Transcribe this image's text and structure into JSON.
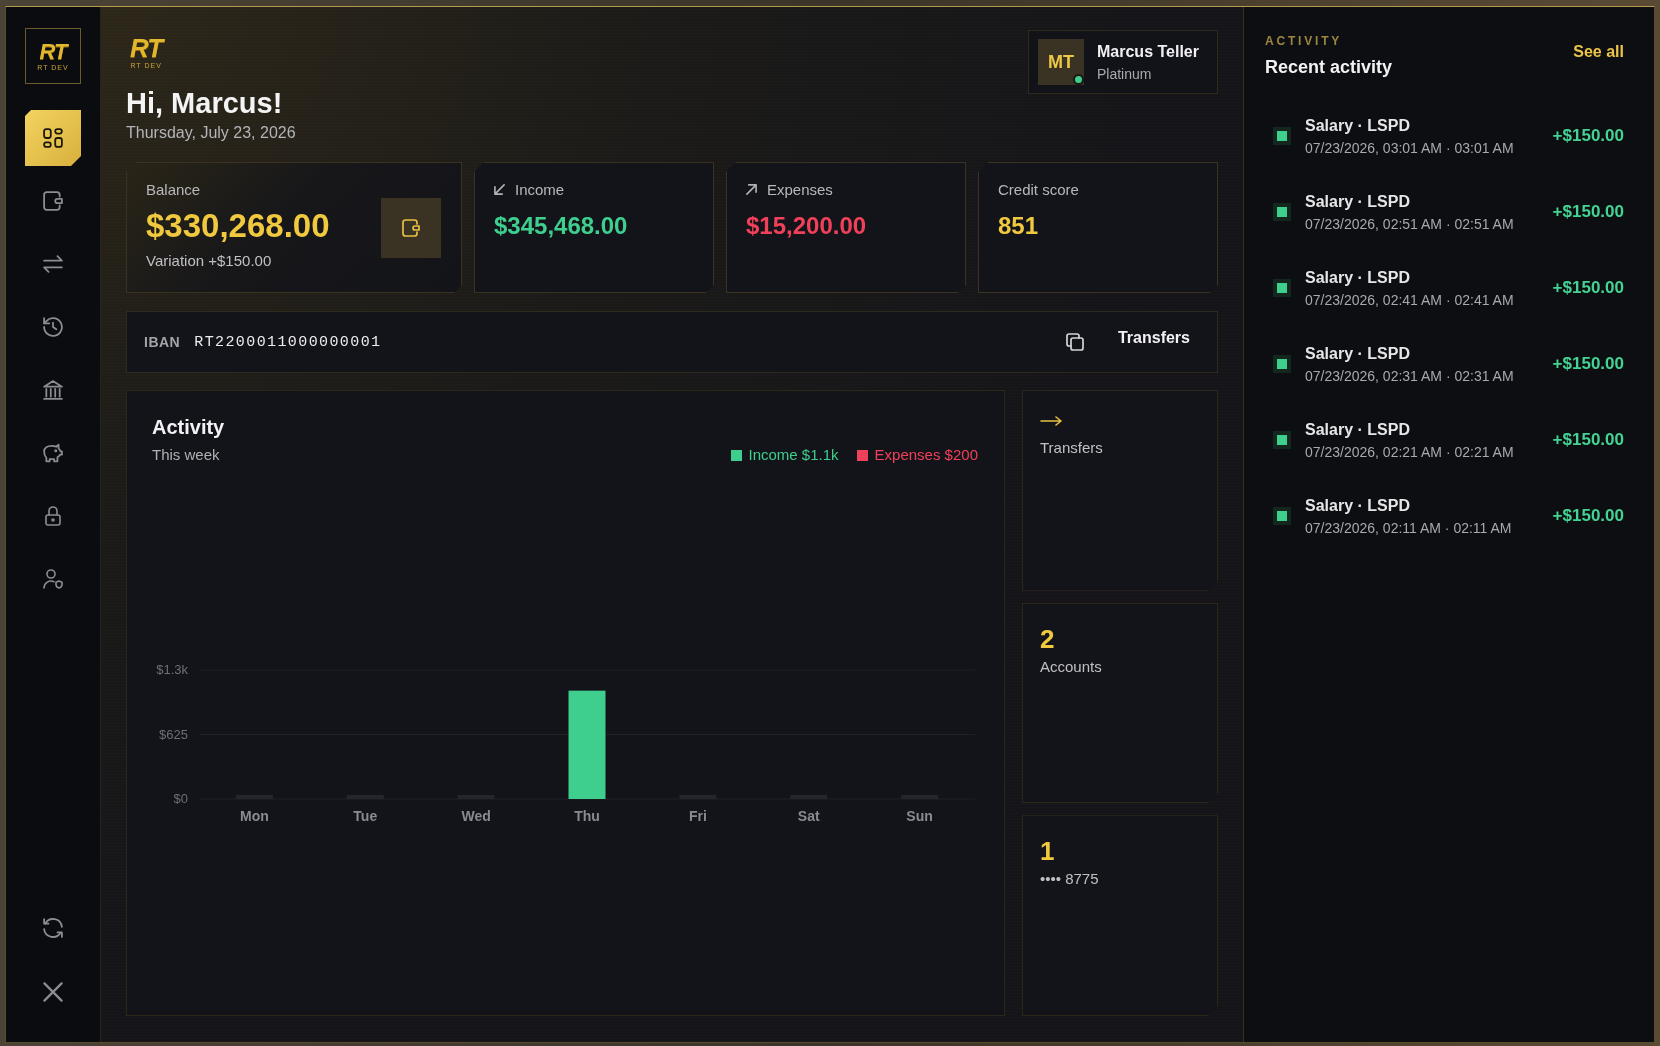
{
  "sidebar": {
    "logo": {
      "mark": "RT",
      "caption": "RT DEV"
    },
    "items": [
      {
        "kind": "dashboard",
        "selected": true
      },
      {
        "kind": "wallet",
        "selected": false
      },
      {
        "kind": "transfers",
        "selected": false
      },
      {
        "kind": "history",
        "selected": false
      },
      {
        "kind": "bank",
        "selected": false
      },
      {
        "kind": "savings",
        "selected": false
      },
      {
        "kind": "security",
        "selected": false
      },
      {
        "kind": "profile",
        "selected": false
      }
    ],
    "bottom_items": [
      {
        "kind": "refresh"
      },
      {
        "kind": "close"
      }
    ]
  },
  "header": {
    "logo": {
      "mark": "RT",
      "caption": "RT DEV"
    },
    "greeting": "Hi, Marcus!",
    "date": "Thursday, July 23, 2026",
    "user": {
      "initials": "MT",
      "name": "Marcus Teller",
      "tier": "Platinum",
      "online": true
    }
  },
  "stats": [
    {
      "kind": "balance",
      "label": "Balance",
      "value": "$330,268.00",
      "note": "Variation +$150.00"
    },
    {
      "kind": "income",
      "label": "Income",
      "value": "$345,468.00"
    },
    {
      "kind": "expenses",
      "label": "Expenses",
      "value": "$15,200.00"
    },
    {
      "kind": "credit",
      "label": "Credit score",
      "value": "851"
    }
  ],
  "iban": {
    "label": "IBAN",
    "value": "RT2200011000000001",
    "action": "Transfers"
  },
  "activity_chart": {
    "title": "Activity",
    "subtitle": "This week",
    "legend_totals": [
      "$1.1k",
      "$200"
    ],
    "chart_data": {
      "type": "bar",
      "categories": [
        "Mon",
        "Tue",
        "Wed",
        "Thu",
        "Fri",
        "Sat",
        "Sun"
      ],
      "series": [
        {
          "name": "Income",
          "color": "#3ecf8e",
          "values": [
            0,
            0,
            0,
            1050,
            0,
            0,
            0
          ]
        },
        {
          "name": "Expenses",
          "color": "#f0405a",
          "values": [
            0,
            0,
            0,
            0,
            0,
            0,
            0
          ]
        }
      ],
      "ylim": [
        0,
        1250
      ],
      "yticks": [
        {
          "value": 0,
          "label": "$0"
        },
        {
          "value": 625,
          "label": "$625"
        },
        {
          "value": 1250,
          "label": "$1.3k"
        }
      ]
    }
  },
  "shortcuts": [
    {
      "kind": "link",
      "label": "Transfers"
    },
    {
      "kind": "count",
      "value": "2",
      "label": "Accounts"
    },
    {
      "kind": "count",
      "value": "1",
      "label": "•••• 8775"
    }
  ],
  "recent_activity": {
    "eyebrow": "ACTIVITY",
    "title": "Recent activity",
    "see_all": "See all",
    "items": [
      {
        "title": "Salary · LSPD",
        "time": "07/23/2026, 03:01 AM · 03:01 AM",
        "amount": "+$150.00"
      },
      {
        "title": "Salary · LSPD",
        "time": "07/23/2026, 02:51 AM · 02:51 AM",
        "amount": "+$150.00"
      },
      {
        "title": "Salary · LSPD",
        "time": "07/23/2026, 02:41 AM · 02:41 AM",
        "amount": "+$150.00"
      },
      {
        "title": "Salary · LSPD",
        "time": "07/23/2026, 02:31 AM · 02:31 AM",
        "amount": "+$150.00"
      },
      {
        "title": "Salary · LSPD",
        "time": "07/23/2026, 02:21 AM · 02:21 AM",
        "amount": "+$150.00"
      },
      {
        "title": "Salary · LSPD",
        "time": "07/23/2026, 02:11 AM · 02:11 AM",
        "amount": "+$150.00"
      }
    ]
  }
}
